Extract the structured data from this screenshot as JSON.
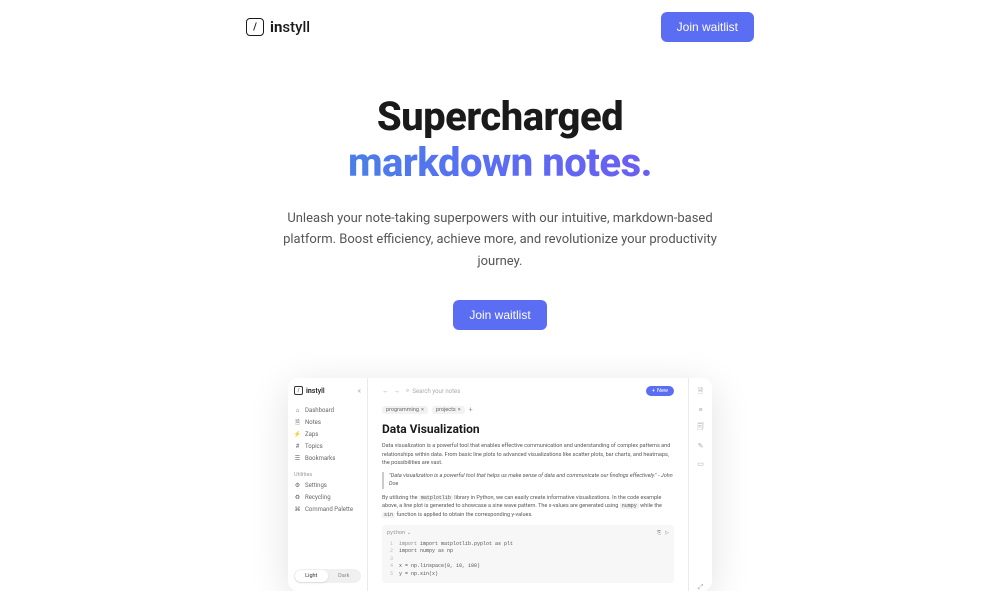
{
  "header": {
    "brand_prefix": "in",
    "brand_suffix": "styll",
    "logo_glyph": "/",
    "cta": "Join waitlist"
  },
  "hero": {
    "title_line1": "Supercharged",
    "title_line2": "markdown notes.",
    "subtitle": "Unleash your note-taking superpowers with our intuitive, markdown-based platform. Boost efficiency, achieve more, and revolutionize your productivity journey.",
    "cta": "Join waitlist"
  },
  "app": {
    "brand_prefix": "in",
    "brand_suffix": "styll",
    "logo_glyph": "/",
    "collapse": "«",
    "nav": [
      {
        "icon": "⌂",
        "label": "Dashboard"
      },
      {
        "icon": "🗎",
        "label": "Notes"
      },
      {
        "icon": "⚡",
        "label": "Zaps"
      },
      {
        "icon": "#",
        "label": "Topics"
      },
      {
        "icon": "☰",
        "label": "Bookmarks"
      }
    ],
    "util_header": "Utilities",
    "utils": [
      {
        "icon": "⚙",
        "label": "Settings"
      },
      {
        "icon": "♻",
        "label": "Recycling"
      },
      {
        "icon": "⌘",
        "label": "Command Palette"
      }
    ],
    "theme": {
      "light": "Light",
      "dark": "Dark"
    },
    "topbar": {
      "back": "←",
      "forward": "→",
      "search_icon": "⌕",
      "search_placeholder": "Search your notes",
      "new_icon": "+",
      "new_label": "New"
    },
    "tags": [
      "programming",
      "projects"
    ],
    "tag_close": "×",
    "tag_add": "+",
    "doc": {
      "title": "Data Visualization",
      "p1": "Data visualization is a powerful tool that enables effective communication and understanding of complex patterns and relationships within data. From basic line plots to advanced visualizations like scatter plots, bar charts, and heatmaps, the possibilities are vast.",
      "quote": "\"Data visualization is a powerful tool that helps us make sense of data and communicate our findings effectively.\" - John Doe",
      "p2a": "By utilizing the ",
      "p2code1": "matplotlib",
      "p2b": " library in Python, we can easily create informative visualizations. In the code example above, a line plot is generated to showcase a sine wave pattern. The x-values are generated using ",
      "p2code2": "numpy",
      "p2c": " while the ",
      "p2code3": "sin",
      "p2d": " function is applied to obtain the corresponding y-values."
    },
    "code": {
      "lang": "python",
      "chev": "⌄",
      "copy": "⎘",
      "run": "▷",
      "lines": [
        "import matplotlib.pyplot as plt",
        "import numpy as np",
        "",
        "x = np.linspace(0, 10, 100)",
        "y = np.sin(x)"
      ]
    },
    "rail_icons": [
      "🗎",
      "≡",
      "🗐",
      "✎",
      "▭",
      "⤢"
    ]
  }
}
